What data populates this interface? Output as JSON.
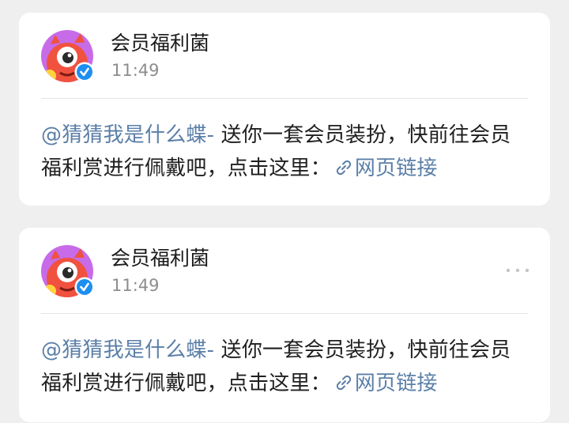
{
  "posts": [
    {
      "account_name": "会员福利菌",
      "time": "11:49",
      "mention": "@猜猜我是什么蝶-",
      "body_text": " 送你一套会员装扮，快前往会员福利赏进行佩戴吧，点击这里：",
      "link_label": "网页链接",
      "show_more": false
    },
    {
      "account_name": "会员福利菌",
      "time": "11:49",
      "mention": "@猜猜我是什么蝶-",
      "body_text": " 送你一套会员装扮，快前往会员福利赏进行佩戴吧，点击这里：",
      "link_label": "网页链接",
      "show_more": true
    }
  ],
  "icons": {
    "avatar": "monster-avatar-icon",
    "verified": "verified-badge-icon",
    "link": "link-icon",
    "more": "more-dots-icon"
  },
  "colors": {
    "background": "#efefef",
    "card": "#ffffff",
    "link_blue": "#5b7fa8",
    "verified_blue": "#1d8ff0",
    "muted_text": "#8d8d8d"
  }
}
